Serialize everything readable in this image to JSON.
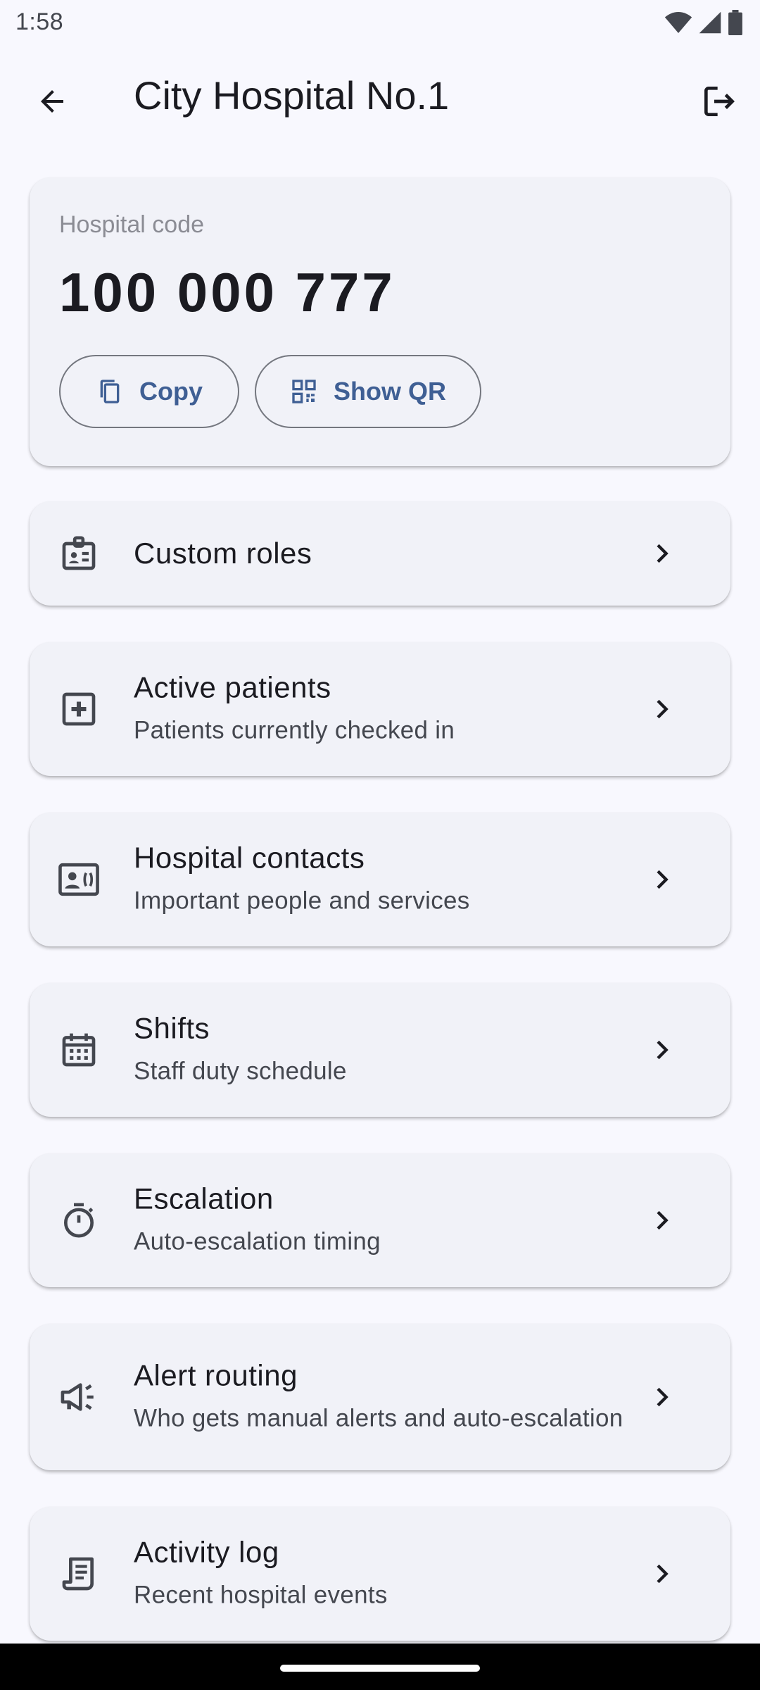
{
  "status_bar": {
    "time": "1:58",
    "icons": [
      "wifi-icon",
      "signal-icon",
      "battery-icon"
    ]
  },
  "app_bar": {
    "title": "City Hospital No.1",
    "back_icon": "arrow-back-icon",
    "logout_icon": "logout-icon"
  },
  "hospital_code": {
    "label": "Hospital code",
    "value": "100 000 777",
    "copy_label": "Copy",
    "qr_label": "Show QR"
  },
  "menu": [
    {
      "title": "Custom roles",
      "subtitle": "",
      "icon": "badge-icon"
    },
    {
      "title": "Active patients",
      "subtitle": "Patients currently checked in",
      "icon": "medical-plus-icon"
    },
    {
      "title": "Hospital contacts",
      "subtitle": "Important people and services",
      "icon": "contact-card-icon"
    },
    {
      "title": "Shifts",
      "subtitle": "Staff duty schedule",
      "icon": "calendar-icon"
    },
    {
      "title": "Escalation",
      "subtitle": "Auto-escalation timing",
      "icon": "timer-icon"
    },
    {
      "title": "Alert routing",
      "subtitle": "Who gets manual alerts and auto-escalation",
      "icon": "campaign-icon"
    },
    {
      "title": "Activity log",
      "subtitle": "Recent hospital events",
      "icon": "receipt-log-icon"
    }
  ],
  "colors": {
    "background": "#f8f8fe",
    "card": "#f1f2f8",
    "accent": "#3f5f94",
    "outline": "#74777f"
  }
}
